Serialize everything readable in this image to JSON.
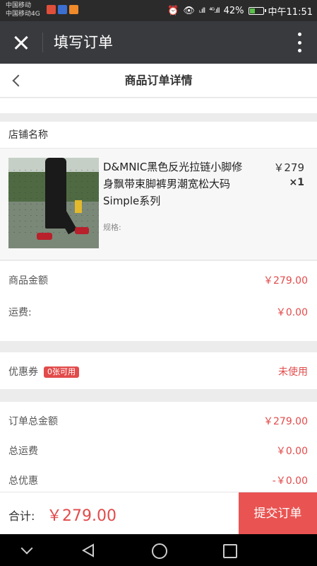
{
  "status_bar": {
    "carrier_1": "中国移动",
    "carrier_2": "中国移动4G",
    "signal_1": "ᵢ.ıll",
    "signal_2": "⁴ᴳ.ıll",
    "battery_level": 0.42,
    "battery": "42%",
    "time": "中午11:51",
    "colors": {
      "icon_red": "#e04f3a",
      "icon_blue": "#3c6fd0",
      "icon_orange": "#f08a2a"
    },
    "icons": [
      "alarm-icon",
      "eye-icon",
      "signal-icon",
      "battery-icon"
    ]
  },
  "app_bar": {
    "title": "填写订单",
    "icons": [
      "close-icon",
      "more-icon"
    ]
  },
  "page": {
    "title": "商品订单详情"
  },
  "shop": {
    "name": "店铺名称"
  },
  "product": {
    "name": "D&MNIC黑色反光拉链小脚修身飘带束脚裤男潮宽松大码Simple系列",
    "spec": "规格:",
    "price": "￥279",
    "qty": "×1"
  },
  "fees": {
    "goods_label": "商品金额",
    "goods_value": "￥279.00",
    "shipping_label": "运费:",
    "shipping_value": "￥0.00"
  },
  "coupon": {
    "label": "优惠券",
    "badge": "0张可用",
    "status": "未使用"
  },
  "summary": {
    "total_label": "订单总金额",
    "total_value": "￥279.00",
    "shipping_label": "总运费",
    "shipping_value": "￥0.00",
    "discount_label": "总优惠",
    "discount_value": "-￥0.00"
  },
  "footer": {
    "total_label": "合计:",
    "total_value": "￥279.00",
    "submit_label": "提交订单"
  },
  "colors": {
    "accent": "#e24b4b",
    "submit": "#e95351",
    "app_bar": "#393a3e"
  }
}
